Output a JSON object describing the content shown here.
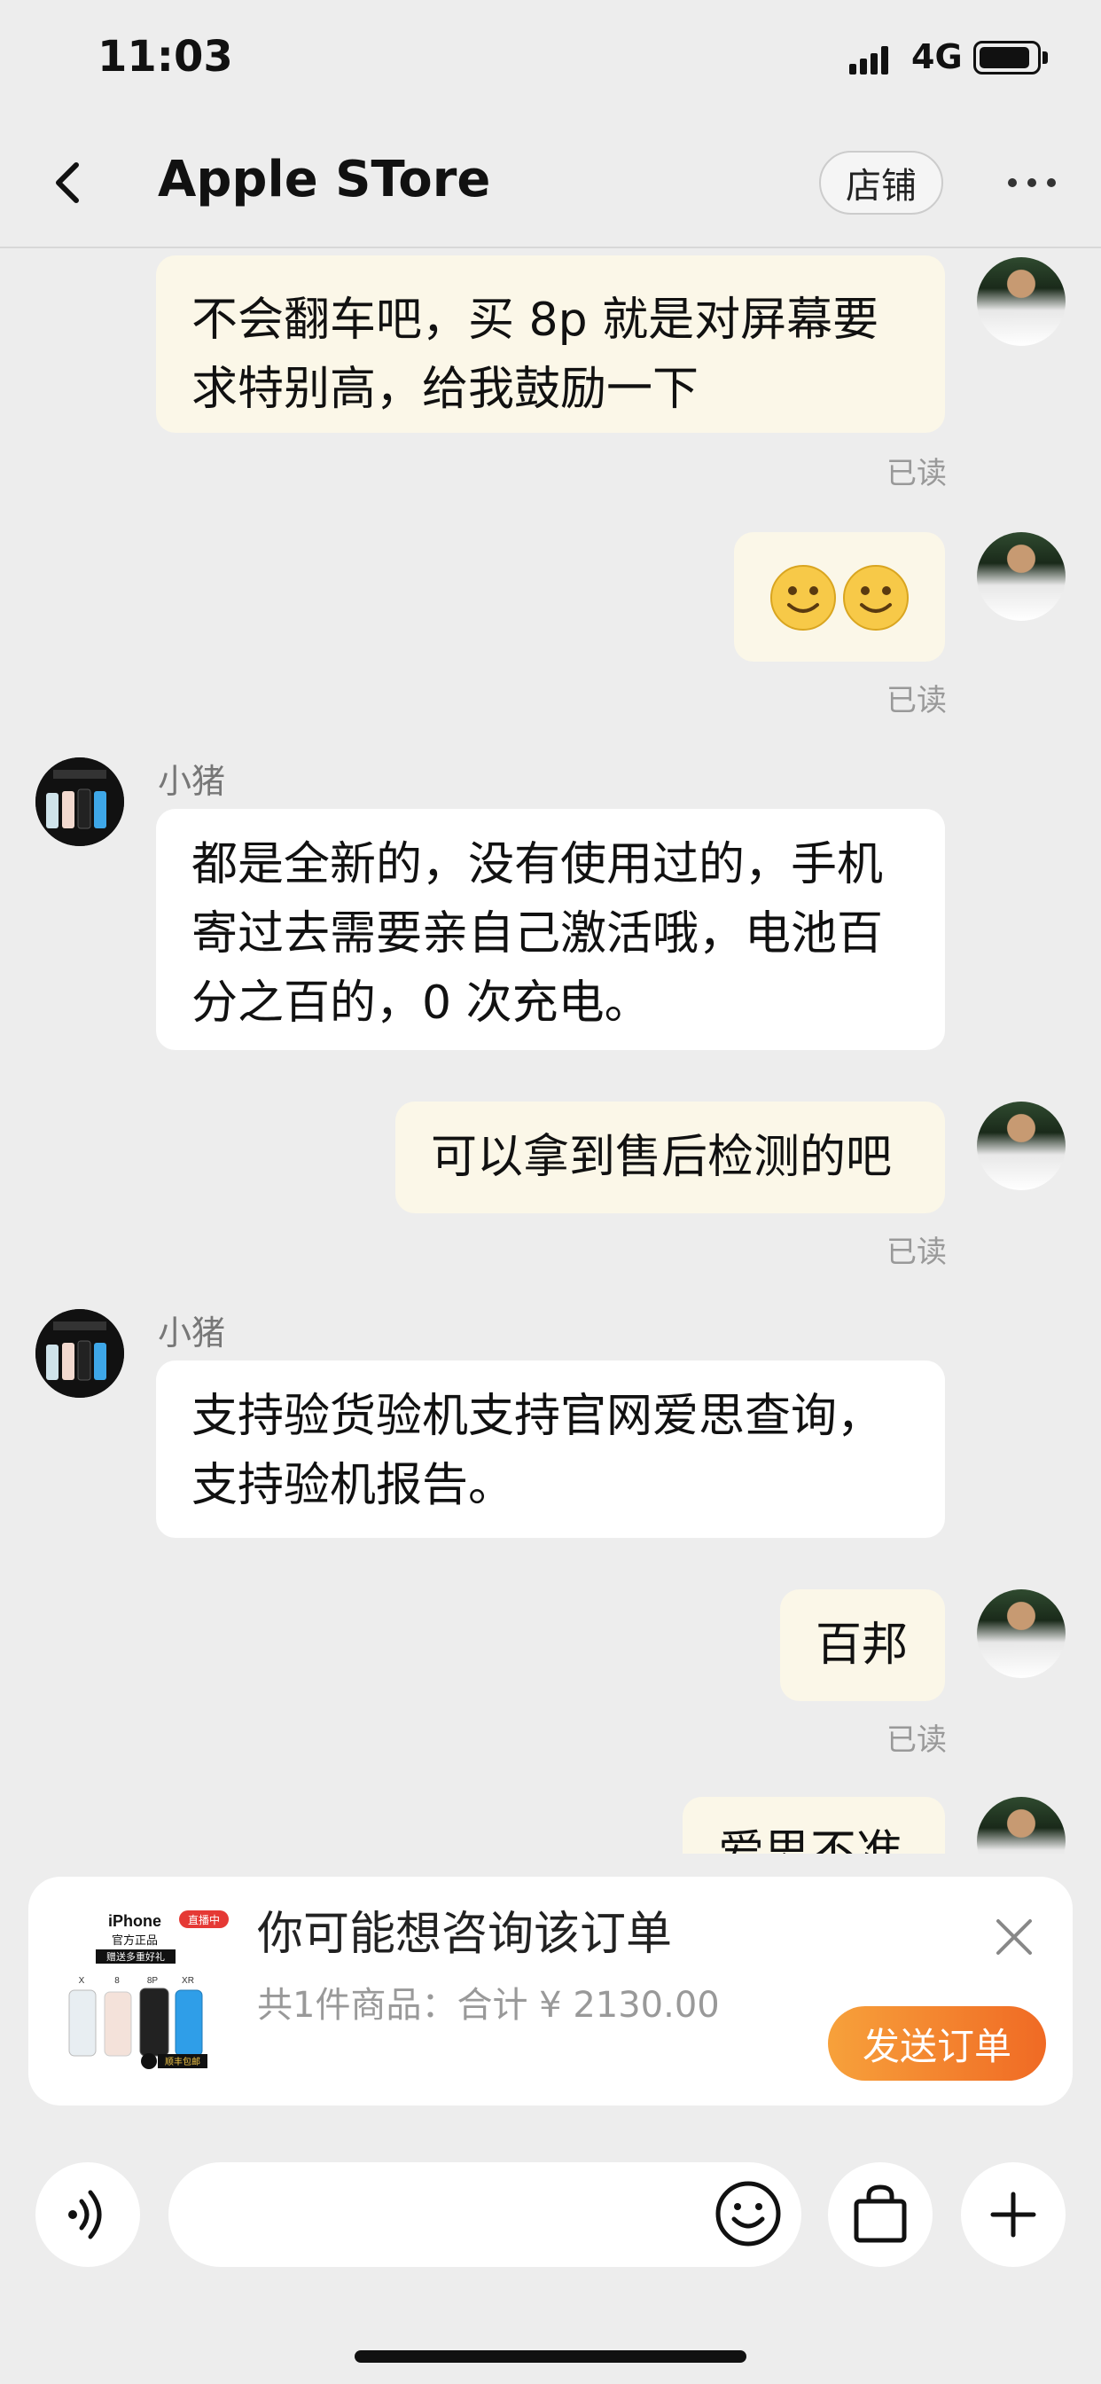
{
  "status": {
    "time": "11:03",
    "network": "4G"
  },
  "header": {
    "title": "Apple STore",
    "store_label": "店铺"
  },
  "messages": [
    {
      "from": "me",
      "text_lines": [
        "不会翻车吧，买 8p 就是对屏幕要",
        "求特别高，给我鼓励一下"
      ],
      "read": "已读"
    },
    {
      "from": "me",
      "text": "🙂🙂",
      "read": "已读"
    },
    {
      "from": "them",
      "name": "小猪",
      "text_lines": [
        "都是全新的，没有使用过的，手机",
        "寄过去需要亲自己激活哦，电池百",
        "分之百的，0 次充电。"
      ]
    },
    {
      "from": "me",
      "text": "可以拿到售后检测的吧",
      "read": "已读"
    },
    {
      "from": "them",
      "name": "小猪",
      "text_lines": [
        "支持验货验机支持官网爱思查询，",
        "支持验机报告。"
      ]
    },
    {
      "from": "me",
      "text": "百邦",
      "read": "已读"
    },
    {
      "from": "me",
      "text": "爱思不准"
    }
  ],
  "order_card": {
    "title": "你可能想咨询该订单",
    "summary": "共1件商品：合计 ¥ 2130.00",
    "send_label": "发送订单",
    "thumb": {
      "brand": "iPhone",
      "sub": "官方正品",
      "badge": "直播中",
      "promo": "赠送多重好礼",
      "models": [
        "X",
        "8",
        "8P",
        "XR"
      ],
      "shipping": "顺丰包邮"
    }
  },
  "input": {
    "placeholder": ""
  },
  "colors": {
    "me_bubble": "#fbf7e8",
    "them_bubble": "#ffffff",
    "send_gradient_start": "#f7a13b",
    "send_gradient_end": "#f06a24"
  }
}
